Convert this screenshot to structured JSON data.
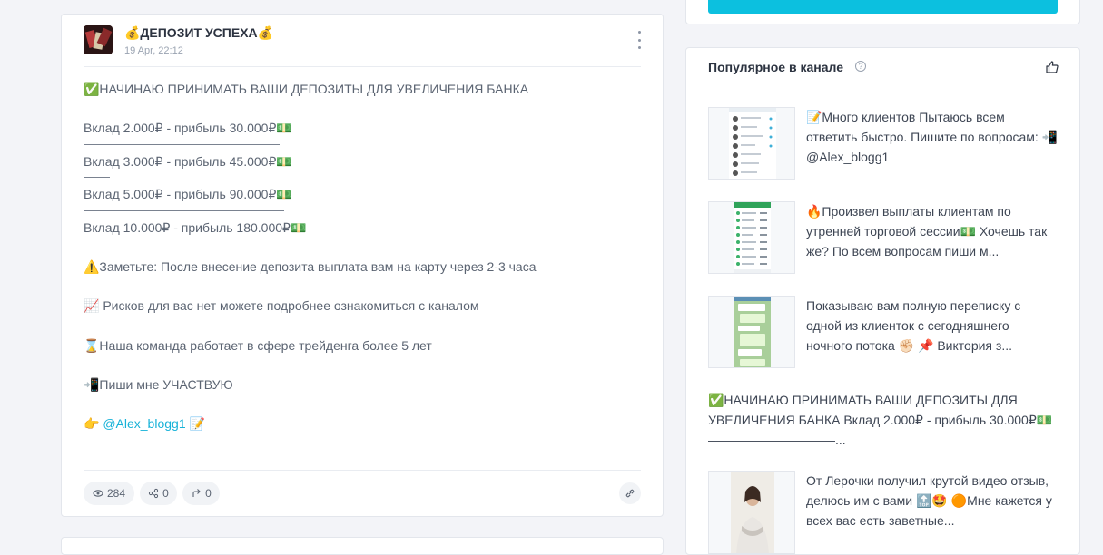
{
  "post": {
    "channel_title": "💰ДЕПОЗИТ УСПЕХА💰",
    "date": "19 Apr, 22:12",
    "lines": {
      "l1": "✅НАЧИНАЮ ПРИНИМАТЬ ВАШИ ДЕПОЗИТЫ ДЛЯ УВЕЛИЧЕНИЯ БАНКА",
      "l2": "Вклад 2.000₽ - прибыль 30.000₽💵",
      "l3": "Вклад 3.000₽ - прибыль 45.000₽💵",
      "l4": "Вклад 5.000₽ - прибыль 90.000₽💵",
      "l5": "Вклад 10.000₽ - прибыль 180.000₽💵",
      "l6": "⚠️Заметьте: После внесение депозита выплата вам на карту через 2-3 часа",
      "l7": "📈 Рисков для вас нет можете подробнее ознакомиться с каналом",
      "l8": "⌛Наша команда работает в сфере трейденга  более 5 лет",
      "l9": "📲Пиши мне УЧАСТВУЮ",
      "l10_prefix": "👉 ",
      "l10_link": "@Alex_blogg1",
      "l10_suffix": "   📝"
    },
    "stats": {
      "views": "284",
      "shares": "0",
      "forwards": "0"
    }
  },
  "popular": {
    "title": "Популярное в канале",
    "help": "?",
    "items": [
      {
        "text": "📝Много клиентов Пытаюсь всем ответить быстро. Пишите по вопросам: 📲 @Alex_blogg1"
      },
      {
        "text": "🔥Произвел выплаты клиентам по утренней торговой сессии💵 Хочешь так же? По всем вопросам пиши м..."
      },
      {
        "text": "Показываю вам полную переписку с одной из клиенток с сегодняшнего ночного потока ✊🏻 📌 Виктория з..."
      },
      {
        "text": "✅НАЧИНАЮ ПРИНИМАТЬ ВАШИ ДЕПОЗИТЫ ДЛЯ УВЕЛИЧЕНИЯ БАНКА Вклад 2.000₽ - прибыль 30.000₽💵 ——————————..."
      },
      {
        "text": "От Лерочки получил крутой видео отзыв, делюсь им с вами 🔝🤩 🟠Мне кажется у всех вас есть заветные..."
      }
    ]
  },
  "colors": {
    "accent": "#0cc0df",
    "link": "#17b2d8",
    "background": "#f3f4f8"
  }
}
